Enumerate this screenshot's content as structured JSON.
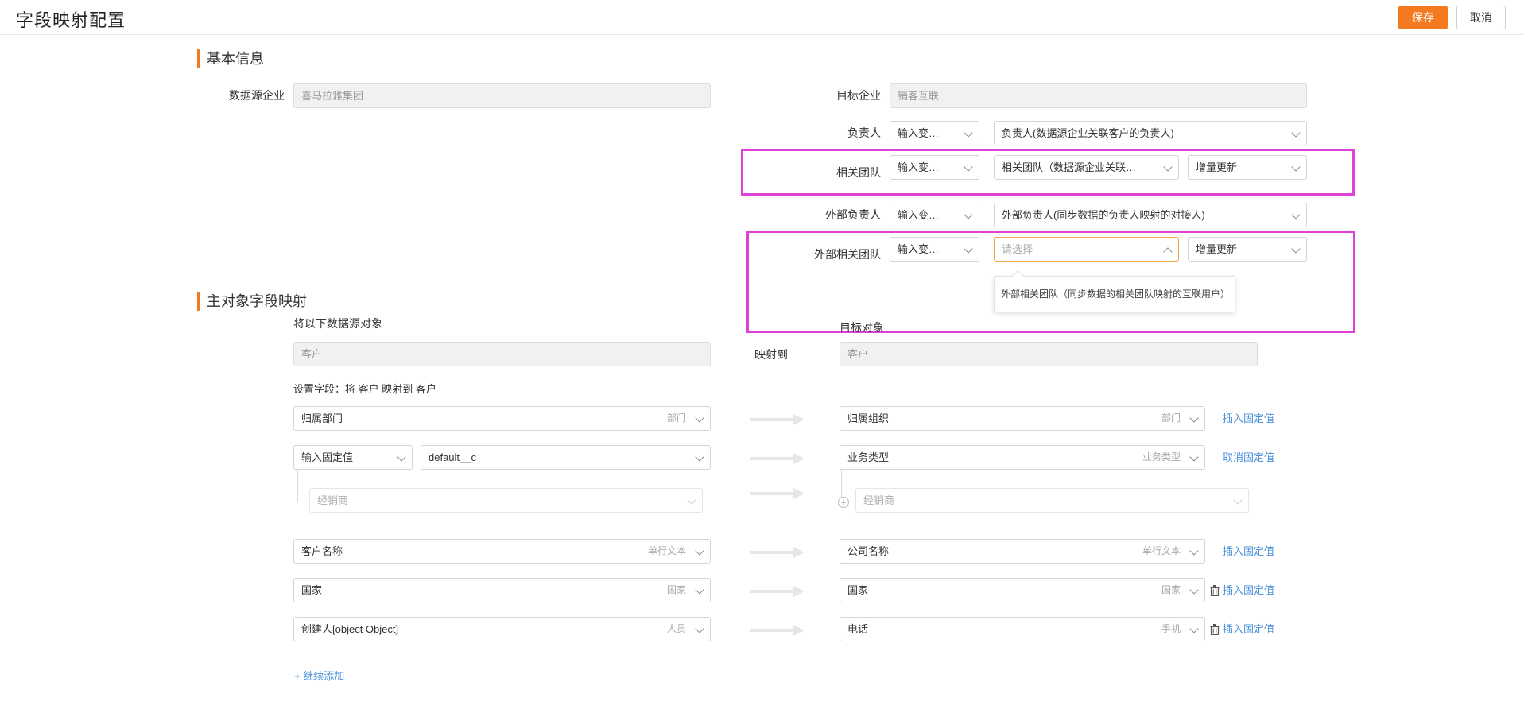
{
  "header": {
    "title": "字段映射配置",
    "save_label": "保存",
    "cancel_label": "取消"
  },
  "basic": {
    "section_title": "基本信息",
    "source_label": "数据源企业",
    "source_value": "喜马拉雅集团",
    "target_label": "目标企业",
    "target_value": "销客互联",
    "rows": [
      {
        "label": "负责人",
        "mode": "输入变量值",
        "value": "负责人(数据源企业关联客户的负责人)"
      },
      {
        "label": "相关团队",
        "mode": "输入变量值",
        "value": "相关团队（数据源企业关联客户的相关团队）",
        "update": "增量更新"
      },
      {
        "label": "外部负责人",
        "mode": "输入变量值",
        "value": "外部负责人(同步数据的负责人映射的对接人)"
      },
      {
        "label": "外部相关团队",
        "mode": "输入变量值",
        "placeholder": "请选择",
        "update": "增量更新"
      }
    ],
    "popup_option": "外部相关团队（同步数据的相关团队映射的互联用户）"
  },
  "mapping": {
    "section_title": "主对象字段映射",
    "source_obj_label": "将以下数据源对象",
    "source_obj_value": "客户",
    "map_to_label": "映射到",
    "target_obj_label": "目标对象",
    "target_obj_value": "客户",
    "field_hint": "设置字段：将 客户 映射到 客户",
    "rows": [
      {
        "src": "归属部门",
        "src_type": "部门",
        "dst": "归属组织",
        "dst_type": "部门",
        "action": "插入固定值"
      },
      {
        "src_mode": "输入固定值",
        "src_value": "default__c",
        "dst": "业务类型",
        "dst_type": "业务类型",
        "action": "取消固定值"
      },
      {
        "src": "经销商",
        "dst": "经销商"
      },
      {
        "src": "客户名称",
        "src_type": "单行文本",
        "dst": "公司名称",
        "dst_type": "单行文本",
        "action": "插入固定值"
      },
      {
        "src": "国家",
        "src_type": "国家",
        "dst": "国家",
        "dst_type": "国家",
        "action": "插入固定值"
      },
      {
        "src": "创建人[object Object]",
        "src_type": "人员",
        "dst": "电话",
        "dst_type": "手机",
        "action": "插入固定值"
      }
    ],
    "add_more": "+ 继续添加"
  },
  "colors": {
    "accent": "#f47a20",
    "highlight": "#e040d8",
    "link": "#4a90d9"
  }
}
